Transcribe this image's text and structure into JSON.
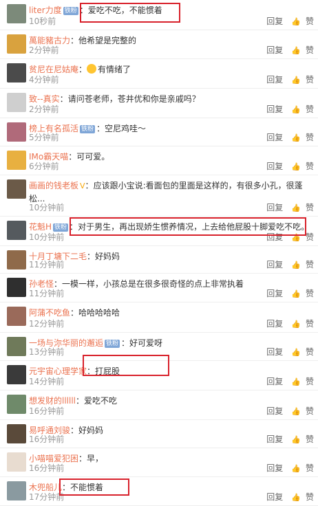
{
  "reply_label": "回复",
  "like_label": "赞",
  "comments": [
    {
      "user": "liter力度",
      "badge": "铁粉",
      "text": "爱吃不吃，不能惯着",
      "time": "10秒前",
      "avatar_color": "#7c8a7a"
    },
    {
      "user": "萬能豬古力",
      "text": "他希望是完整的",
      "time": "2分钟前",
      "avatar_color": "#d9a23e"
    },
    {
      "user": "贫尼在尼姑庵",
      "text": "有情绪了",
      "time": "4分钟前",
      "avatar_color": "#4b4b4b"
    },
    {
      "user": "致--真实",
      "text": "请问苍老师，苍井优和你是亲戚吗？",
      "time": "2分钟前",
      "avatar_color": "#cfcfcf"
    },
    {
      "user": "榜上有名孤活",
      "badge": "铁粉",
      "text": "空尼鸡哇～",
      "time": "5分钟前",
      "avatar_color": "#b06a7a"
    },
    {
      "user": "IMo霸天喵",
      "text": "可可爱。",
      "time": "6分钟前",
      "avatar_color": "#e8b040"
    },
    {
      "user": "画画的钱老板",
      "vip": "V",
      "text": "应该跟小宝说:看面包的里面是这样的，有很多小孔，很蓬松...",
      "time": "10分钟前",
      "avatar_color": "#6b5a48"
    },
    {
      "user": "花魁H",
      "badge": "铁粉",
      "text": "对于男生，再出现娇生惯养情况，上去给他屁股十脚爱吃不吃。",
      "time": "10分钟前",
      "avatar_color": "#555a5e"
    },
    {
      "user": "十月丁墉下二毛",
      "text": "好妈妈",
      "time": "11分钟前",
      "avatar_color": "#8f6a4a"
    },
    {
      "user": "孙老怪",
      "text": "一模一样，小孩总是在很多很奇怪的点上非常执着",
      "time": "11分钟前",
      "avatar_color": "#2f2f2f"
    },
    {
      "user": "阿蒲不吃鱼",
      "text": "哈哈哈哈哈",
      "time": "12分钟前",
      "avatar_color": "#9a6a5a"
    },
    {
      "user": "一场与沵华丽的邂逅",
      "badge": "铁粉",
      "text": "好可爱呀",
      "time": "13分钟前",
      "avatar_color": "#6f7a5a"
    },
    {
      "user": "元宇宙心理学家",
      "text": "打屁股",
      "time": "14分钟前",
      "avatar_color": "#3a3a3a"
    },
    {
      "user": "想发财的llllll",
      "text": "爱吃不吃",
      "time": "16分钟前",
      "avatar_color": "#6f8a6a"
    },
    {
      "user": "易呼通刘骏",
      "text": "好妈妈",
      "time": "16分钟前",
      "avatar_color": "#5a4a3a"
    },
    {
      "user": "小喵喵爱犯困",
      "text": "早，",
      "time": "16分钟前",
      "avatar_color": "#e8dcd0"
    },
    {
      "user": "木兜船儿",
      "text": "不能惯着",
      "time": "17分钟前",
      "avatar_color": "#8a9aa0"
    }
  ]
}
